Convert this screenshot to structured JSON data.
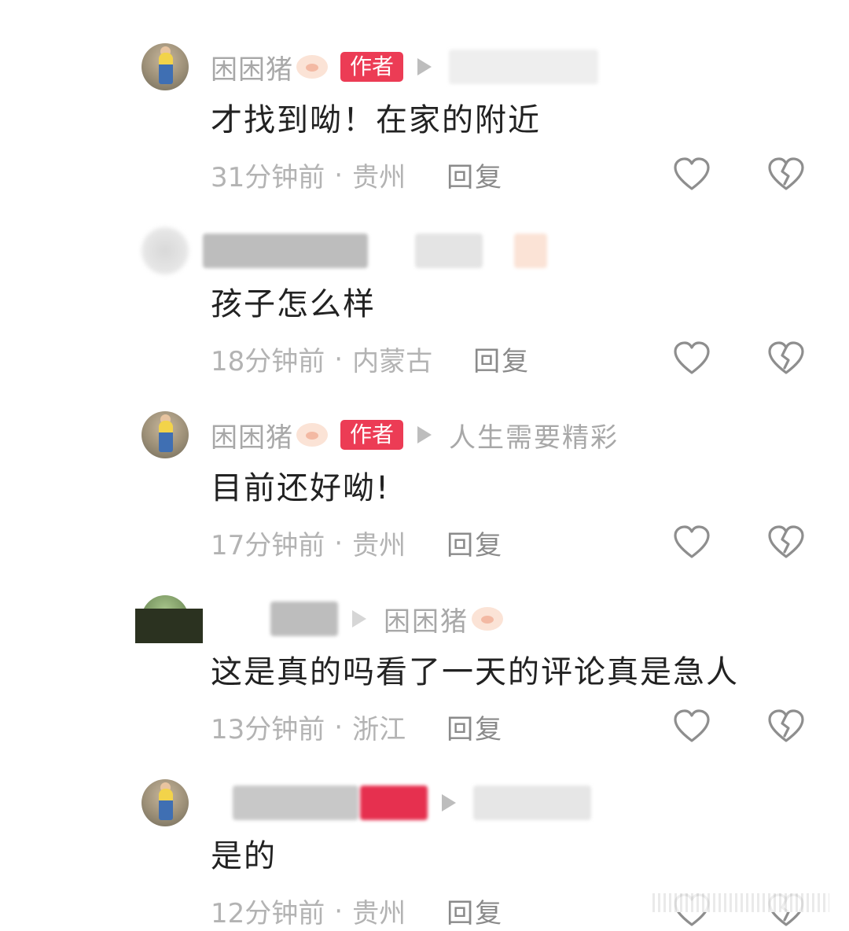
{
  "colors": {
    "author_badge": "#ec3c55",
    "text": "#222222",
    "meta": "#b3b3b3",
    "icon": "#8e8e8e"
  },
  "comments": [
    {
      "username": "困困猪",
      "badge": "作者",
      "reply_to": "",
      "text": "才找到呦！在家的附近",
      "time": "31分钟前",
      "location": "贵州",
      "reply_label": "回复"
    },
    {
      "username": "",
      "badge": "",
      "reply_to": "",
      "text": "孩子怎么样",
      "time": "18分钟前",
      "location": "内蒙古",
      "reply_label": "回复"
    },
    {
      "username": "困困猪",
      "badge": "作者",
      "reply_to": "人生需要精彩",
      "text": "目前还好呦!",
      "time": "17分钟前",
      "location": "贵州",
      "reply_label": "回复"
    },
    {
      "username": "",
      "badge": "",
      "reply_to": "困困猪",
      "text": "这是真的吗看了一天的评论真是急人",
      "time": "13分钟前",
      "location": "浙江",
      "reply_label": "回复"
    },
    {
      "username": "",
      "badge": "",
      "reply_to": "",
      "text": "是的",
      "time": "12分钟前",
      "location": "贵州",
      "reply_label": "回复"
    }
  ],
  "icons": {
    "like": "heart-icon",
    "dislike": "broken-heart-icon",
    "author": "pig-icon"
  }
}
